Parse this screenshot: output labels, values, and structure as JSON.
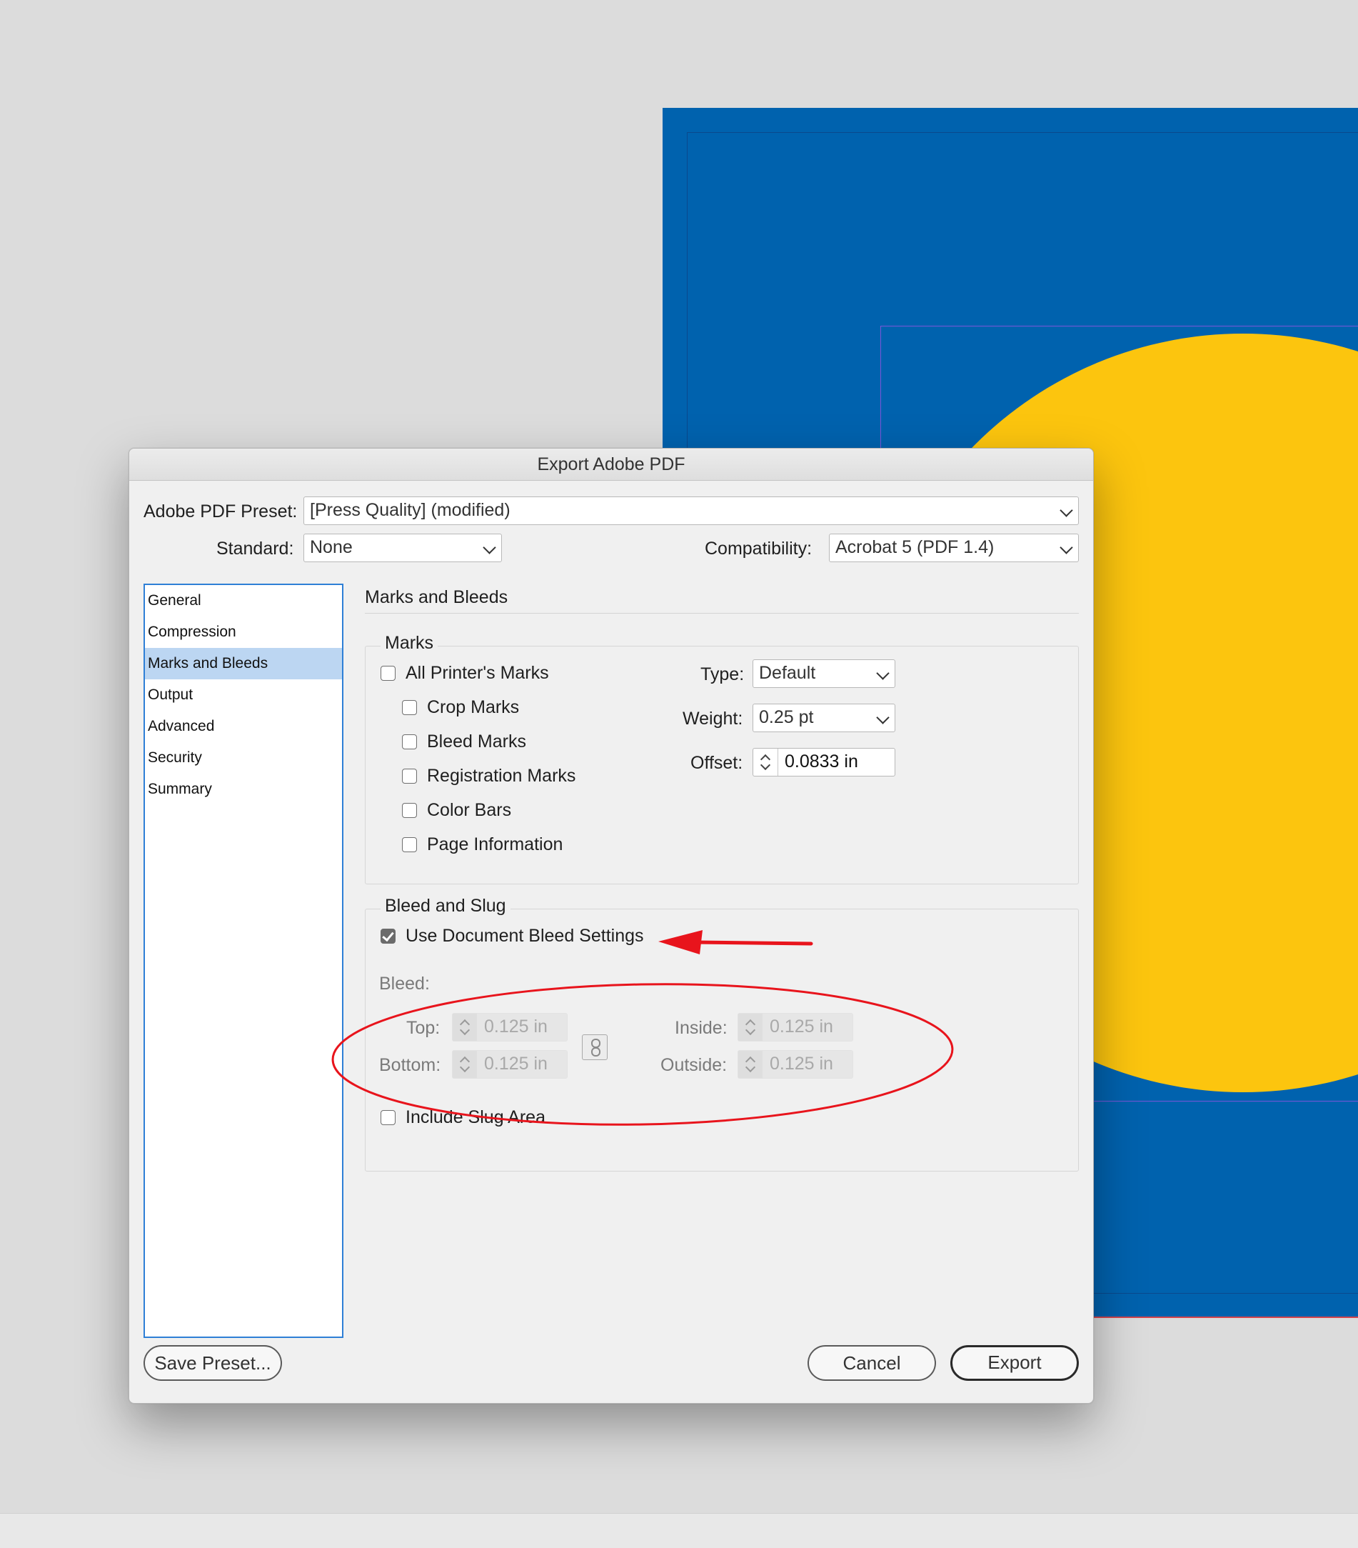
{
  "dialog": {
    "title": "Export Adobe PDF",
    "preset_label": "Adobe PDF Preset:",
    "preset_value": "[Press Quality] (modified)",
    "standard_label": "Standard:",
    "standard_value": "None",
    "compat_label": "Compatibility:",
    "compat_value": "Acrobat 5 (PDF 1.4)"
  },
  "sidebar": {
    "items": [
      {
        "label": "General"
      },
      {
        "label": "Compression"
      },
      {
        "label": "Marks and Bleeds",
        "selected": true
      },
      {
        "label": "Output"
      },
      {
        "label": "Advanced"
      },
      {
        "label": "Security"
      },
      {
        "label": "Summary"
      }
    ]
  },
  "main": {
    "section_title": "Marks and Bleeds",
    "marks": {
      "legend": "Marks",
      "all_printers_marks": {
        "label": "All Printer's Marks",
        "checked": false
      },
      "crop_marks": {
        "label": "Crop Marks",
        "checked": false
      },
      "bleed_marks": {
        "label": "Bleed Marks",
        "checked": false
      },
      "registration_marks": {
        "label": "Registration Marks",
        "checked": false
      },
      "color_bars": {
        "label": "Color Bars",
        "checked": false
      },
      "page_information": {
        "label": "Page Information",
        "checked": false
      },
      "type_label": "Type:",
      "type_value": "Default",
      "weight_label": "Weight:",
      "weight_value": "0.25 pt",
      "offset_label": "Offset:",
      "offset_value": "0.0833 in"
    },
    "bleed_slug": {
      "legend": "Bleed and Slug",
      "use_doc_bleed": {
        "label": "Use Document Bleed Settings",
        "checked": true
      },
      "bleed_label": "Bleed:",
      "top_label": "Top:",
      "top_value": "0.125 in",
      "bottom_label": "Bottom:",
      "bottom_value": "0.125 in",
      "inside_label": "Inside:",
      "inside_value": "0.125 in",
      "outside_label": "Outside:",
      "outside_value": "0.125 in",
      "include_slug": {
        "label": "Include Slug Area",
        "checked": false
      }
    }
  },
  "buttons": {
    "save_preset": "Save Preset...",
    "cancel": "Cancel",
    "export": "Export"
  },
  "colors": {
    "document_background": "#0062ae",
    "document_circle": "#fcc50e",
    "sidebar_selection": "#bcd6f2",
    "annotation_red": "#e8141c"
  }
}
